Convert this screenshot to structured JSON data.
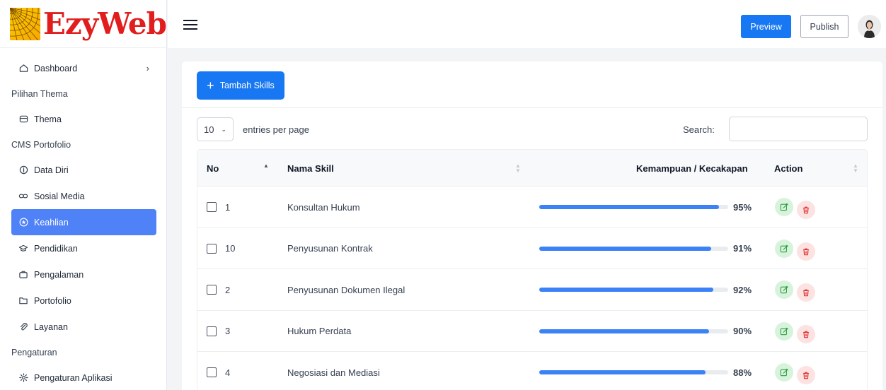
{
  "brand": {
    "name": "EzyWeb"
  },
  "sidebar": {
    "dashboard": "Dashboard",
    "group_theme": "Pilihan Thema",
    "theme": "Thema",
    "group_cms": "CMS Portofolio",
    "data_diri": "Data Diri",
    "sosial_media": "Sosial Media",
    "keahlian": "Keahlian",
    "pendidikan": "Pendidikan",
    "pengalaman": "Pengalaman",
    "portofolio": "Portofolio",
    "layanan": "Layanan",
    "group_settings": "Pengaturan",
    "pengaturan_aplikasi": "Pengaturan Aplikasi"
  },
  "topbar": {
    "preview_label": "Preview",
    "publish_label": "Publish"
  },
  "toolbar": {
    "add_label": "Tambah Skills"
  },
  "table_controls": {
    "entries_value": "10",
    "entries_label": "entries per page",
    "search_label": "Search:"
  },
  "table": {
    "headers": {
      "no": "No",
      "name": "Nama Skill",
      "level": "Kemampuan / Kecakapan",
      "action": "Action"
    },
    "rows": [
      {
        "no": "1",
        "name": "Konsultan Hukum",
        "percent": 95,
        "percent_label": "95%"
      },
      {
        "no": "10",
        "name": "Penyusunan Kontrak",
        "percent": 91,
        "percent_label": "91%"
      },
      {
        "no": "2",
        "name": "Penyusunan Dokumen Ilegal",
        "percent": 92,
        "percent_label": "92%"
      },
      {
        "no": "3",
        "name": "Hukum Perdata",
        "percent": 90,
        "percent_label": "90%"
      },
      {
        "no": "4",
        "name": "Negosiasi dan Mediasi",
        "percent": 88,
        "percent_label": "88%"
      }
    ]
  },
  "colors": {
    "primary": "#1877f2",
    "active_nav": "#4f82f7",
    "progress": "#3b82f6",
    "edit_bg": "#d8f3dc",
    "delete_bg": "#fde2e2",
    "logo_red": "#e11d1d"
  },
  "icons": {
    "dashboard": "home-icon",
    "theme": "palette-icon",
    "data_diri": "info-icon",
    "sosial_media": "link-icon",
    "keahlian": "star-icon",
    "pendidikan": "graduation-cap-icon",
    "pengalaman": "briefcase-icon",
    "portofolio": "folder-icon",
    "layanan": "paperclip-icon",
    "pengaturan_aplikasi": "gear-icon",
    "edit": "edit-icon",
    "delete": "trash-icon"
  }
}
